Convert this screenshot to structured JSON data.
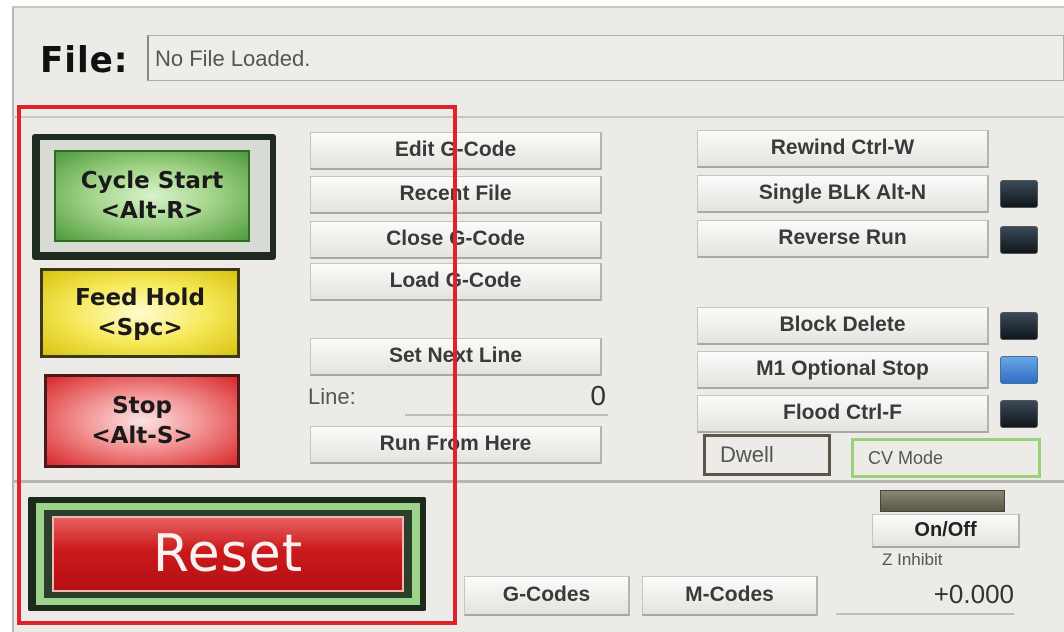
{
  "file": {
    "label": "File:",
    "value": "No File Loaded."
  },
  "program_buttons": {
    "cycle_start": {
      "line1": "Cycle Start",
      "line2": "<Alt-R>"
    },
    "feed_hold": {
      "line1": "Feed Hold",
      "line2": "<Spc>"
    },
    "stop": {
      "line1": "Stop",
      "line2": "<Alt-S>"
    },
    "reset": "Reset"
  },
  "gcode_buttons": {
    "edit": "Edit G-Code",
    "recent": "Recent File",
    "close": "Close G-Code",
    "load": "Load G-Code",
    "set_next_line": "Set Next Line",
    "run_from_here": "Run From Here"
  },
  "line": {
    "label": "Line:",
    "value": "0"
  },
  "toggle_buttons": {
    "rewind": "Rewind Ctrl-W",
    "single_blk": "Single BLK Alt-N",
    "reverse_run": "Reverse Run",
    "block_delete": "Block Delete",
    "m1_optional_stop": "M1 Optional Stop",
    "flood": "Flood Ctrl-F"
  },
  "indicators": {
    "single_blk": "off",
    "reverse_run": "off",
    "block_delete": "off",
    "m1_optional_stop": "on",
    "flood": "off"
  },
  "status": {
    "dwell": "Dwell",
    "cv_mode": "CV Mode"
  },
  "bottom": {
    "g_codes": "G-Codes",
    "m_codes": "M-Codes",
    "on_off": "On/Off",
    "z_inhibit": "Z Inhibit",
    "z_value": "+0.000"
  },
  "colors": {
    "highlight": "#e0232b",
    "cycle_start": "#4f9a3c",
    "feed_hold": "#f6e95a",
    "stop": "#d8282a",
    "reset": "#cc1a1c",
    "led_on": "#2f6ec3",
    "led_off": "#10161c"
  }
}
